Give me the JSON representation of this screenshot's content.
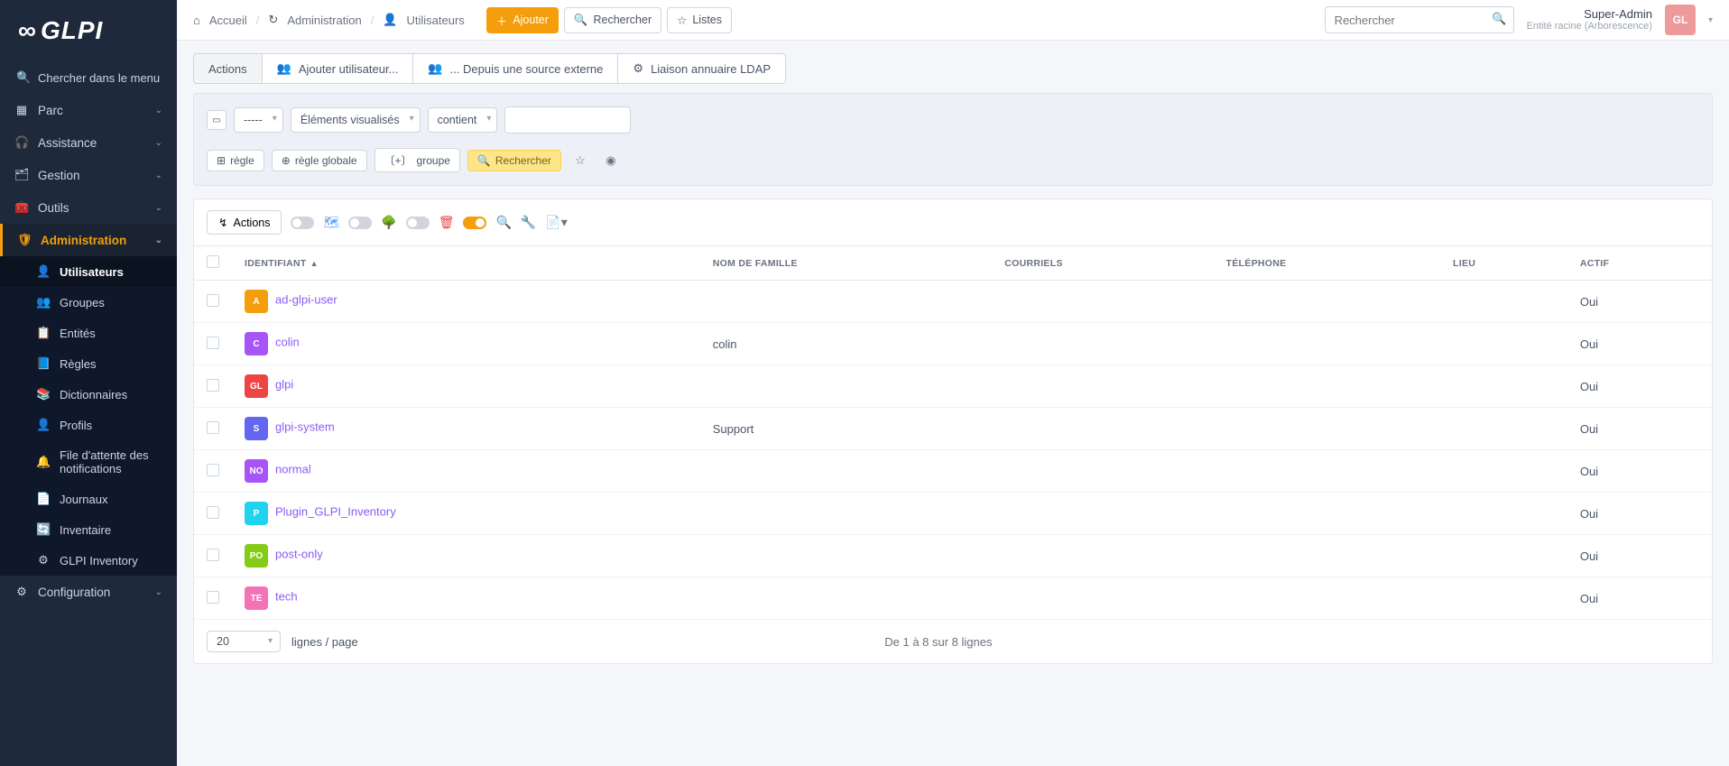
{
  "logo": "GLPI",
  "sidebar": {
    "search_label": "Chercher dans le menu",
    "groups": [
      {
        "label": "Parc",
        "icon": "▦"
      },
      {
        "label": "Assistance",
        "icon": "🎧"
      },
      {
        "label": "Gestion",
        "icon": "🗂"
      },
      {
        "label": "Outils",
        "icon": "🧰"
      }
    ],
    "admin_label": "Administration",
    "admin_icon": "🛡",
    "admin_items": [
      {
        "label": "Utilisateurs",
        "icon": "👤",
        "active": true
      },
      {
        "label": "Groupes",
        "icon": "👥"
      },
      {
        "label": "Entités",
        "icon": "📋"
      },
      {
        "label": "Règles",
        "icon": "📘"
      },
      {
        "label": "Dictionnaires",
        "icon": "📚"
      },
      {
        "label": "Profils",
        "icon": "👤"
      },
      {
        "label": "File d'attente des notifications",
        "icon": "🔔"
      },
      {
        "label": "Journaux",
        "icon": "📄"
      },
      {
        "label": "Inventaire",
        "icon": "🔄"
      },
      {
        "label": "GLPI Inventory",
        "icon": "⚙"
      }
    ],
    "config_label": "Configuration",
    "config_icon": "⚙"
  },
  "breadcrumbs": [
    {
      "label": "Accueil",
      "icon": "⌂"
    },
    {
      "label": "Administration",
      "icon": "↻"
    },
    {
      "label": "Utilisateurs",
      "icon": "👤"
    }
  ],
  "top_actions": {
    "add": "Ajouter",
    "search": "Rechercher",
    "lists": "Listes"
  },
  "global_search_placeholder": "Rechercher",
  "user": {
    "name": "Super-Admin",
    "entity": "Entité racine (Arborescence)",
    "initials": "GL"
  },
  "tabs": [
    {
      "label": "Actions"
    },
    {
      "label": "Ajouter utilisateur...",
      "icon": "👥+"
    },
    {
      "label": "... Depuis une source externe",
      "icon": "👥"
    },
    {
      "label": "Liaison annuaire LDAP",
      "icon": "⚙"
    }
  ],
  "filter": {
    "field1": "-----",
    "field2": "Éléments visualisés",
    "field3": "contient",
    "rule": "règle",
    "global_rule": "règle globale",
    "group": "groupe",
    "search": "Rechercher"
  },
  "table": {
    "actions_btn": "Actions",
    "columns": {
      "id": "Identifiant",
      "lastname": "Nom de famille",
      "emails": "Courriels",
      "phone": "Téléphone",
      "location": "Lieu",
      "active": "Actif"
    },
    "rows": [
      {
        "initials": "A",
        "color": "#f59e0b",
        "id": "ad-glpi-user",
        "lastname": "",
        "active": "Oui"
      },
      {
        "initials": "C",
        "color": "#a855f7",
        "id": "colin",
        "lastname": "colin",
        "active": "Oui"
      },
      {
        "initials": "GL",
        "color": "#ef4444",
        "id": "glpi",
        "lastname": "",
        "active": "Oui"
      },
      {
        "initials": "S",
        "color": "#6366f1",
        "id": "glpi-system",
        "lastname": "Support",
        "active": "Oui"
      },
      {
        "initials": "NO",
        "color": "#a855f7",
        "id": "normal",
        "lastname": "",
        "active": "Oui"
      },
      {
        "initials": "P",
        "color": "#22d3ee",
        "id": "Plugin_GLPI_Inventory",
        "lastname": "",
        "active": "Oui"
      },
      {
        "initials": "PO",
        "color": "#84cc16",
        "id": "post-only",
        "lastname": "",
        "active": "Oui"
      },
      {
        "initials": "TE",
        "color": "#f472b6",
        "id": "tech",
        "lastname": "",
        "active": "Oui"
      }
    ],
    "page_size": "20",
    "page_label": "lignes / page",
    "range": "De 1 à 8 sur 8 lignes"
  }
}
